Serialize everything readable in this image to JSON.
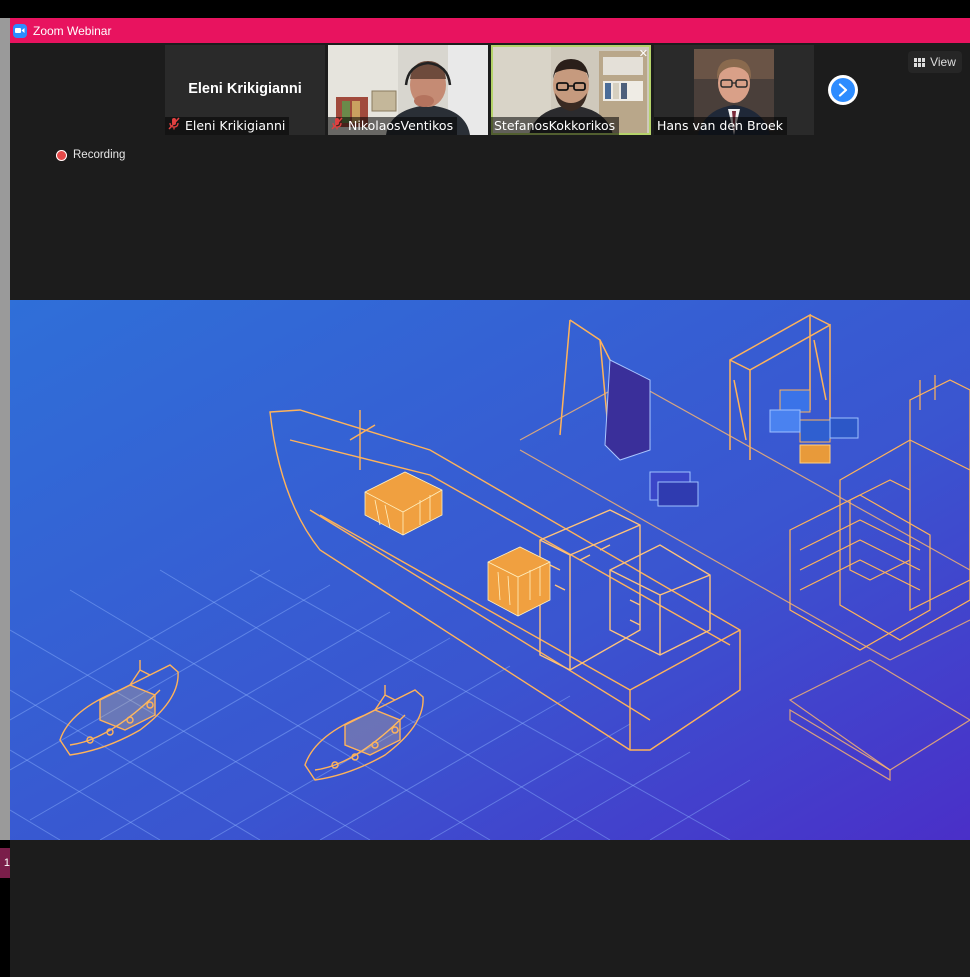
{
  "window": {
    "title": "Zoom Webinar"
  },
  "participants": [
    {
      "name": "Eleni Krikigianni",
      "display_name": "Eleni Krikigianni",
      "muted": true,
      "video": false
    },
    {
      "name": "NikolaosVentikos",
      "muted": true,
      "video": true
    },
    {
      "name": "StefanosKokkorikos",
      "muted": false,
      "video": true,
      "active_speaker": true
    },
    {
      "name": "Hans van den Broek",
      "muted": false,
      "video": true
    }
  ],
  "controls": {
    "view_label": "View",
    "next_page_icon": "chevron-right-icon"
  },
  "recording": {
    "label": "Recording"
  },
  "side_badge": "1",
  "colors": {
    "titlebar": "#e8135f",
    "accent": "#2d8cff",
    "active_border": "#b5d36a",
    "slide_bg_start": "#2f6fd8",
    "slide_bg_end": "#4a2fc8",
    "line_orange": "#f0a040"
  }
}
